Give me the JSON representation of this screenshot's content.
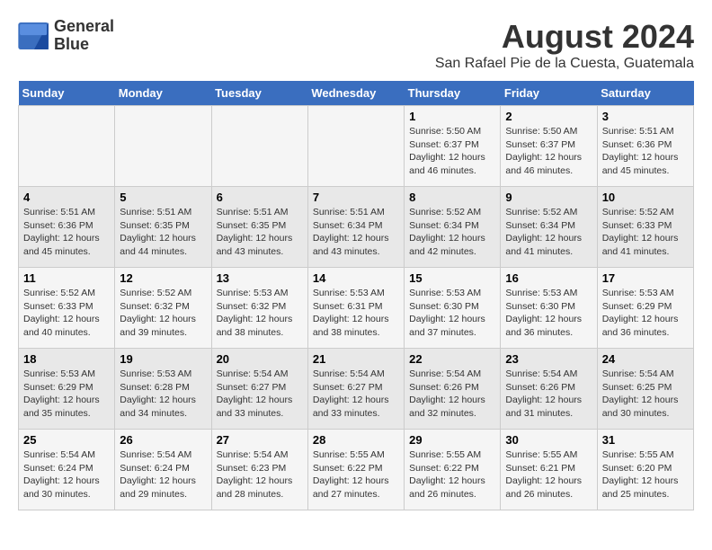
{
  "logo": {
    "line1": "General",
    "line2": "Blue"
  },
  "title": "August 2024",
  "subtitle": "San Rafael Pie de la Cuesta, Guatemala",
  "days_of_week": [
    "Sunday",
    "Monday",
    "Tuesday",
    "Wednesday",
    "Thursday",
    "Friday",
    "Saturday"
  ],
  "weeks": [
    [
      {
        "day": "",
        "info": ""
      },
      {
        "day": "",
        "info": ""
      },
      {
        "day": "",
        "info": ""
      },
      {
        "day": "",
        "info": ""
      },
      {
        "day": "1",
        "info": "Sunrise: 5:50 AM\nSunset: 6:37 PM\nDaylight: 12 hours\nand 46 minutes."
      },
      {
        "day": "2",
        "info": "Sunrise: 5:50 AM\nSunset: 6:37 PM\nDaylight: 12 hours\nand 46 minutes."
      },
      {
        "day": "3",
        "info": "Sunrise: 5:51 AM\nSunset: 6:36 PM\nDaylight: 12 hours\nand 45 minutes."
      }
    ],
    [
      {
        "day": "4",
        "info": "Sunrise: 5:51 AM\nSunset: 6:36 PM\nDaylight: 12 hours\nand 45 minutes."
      },
      {
        "day": "5",
        "info": "Sunrise: 5:51 AM\nSunset: 6:35 PM\nDaylight: 12 hours\nand 44 minutes."
      },
      {
        "day": "6",
        "info": "Sunrise: 5:51 AM\nSunset: 6:35 PM\nDaylight: 12 hours\nand 43 minutes."
      },
      {
        "day": "7",
        "info": "Sunrise: 5:51 AM\nSunset: 6:34 PM\nDaylight: 12 hours\nand 43 minutes."
      },
      {
        "day": "8",
        "info": "Sunrise: 5:52 AM\nSunset: 6:34 PM\nDaylight: 12 hours\nand 42 minutes."
      },
      {
        "day": "9",
        "info": "Sunrise: 5:52 AM\nSunset: 6:34 PM\nDaylight: 12 hours\nand 41 minutes."
      },
      {
        "day": "10",
        "info": "Sunrise: 5:52 AM\nSunset: 6:33 PM\nDaylight: 12 hours\nand 41 minutes."
      }
    ],
    [
      {
        "day": "11",
        "info": "Sunrise: 5:52 AM\nSunset: 6:33 PM\nDaylight: 12 hours\nand 40 minutes."
      },
      {
        "day": "12",
        "info": "Sunrise: 5:52 AM\nSunset: 6:32 PM\nDaylight: 12 hours\nand 39 minutes."
      },
      {
        "day": "13",
        "info": "Sunrise: 5:53 AM\nSunset: 6:32 PM\nDaylight: 12 hours\nand 38 minutes."
      },
      {
        "day": "14",
        "info": "Sunrise: 5:53 AM\nSunset: 6:31 PM\nDaylight: 12 hours\nand 38 minutes."
      },
      {
        "day": "15",
        "info": "Sunrise: 5:53 AM\nSunset: 6:30 PM\nDaylight: 12 hours\nand 37 minutes."
      },
      {
        "day": "16",
        "info": "Sunrise: 5:53 AM\nSunset: 6:30 PM\nDaylight: 12 hours\nand 36 minutes."
      },
      {
        "day": "17",
        "info": "Sunrise: 5:53 AM\nSunset: 6:29 PM\nDaylight: 12 hours\nand 36 minutes."
      }
    ],
    [
      {
        "day": "18",
        "info": "Sunrise: 5:53 AM\nSunset: 6:29 PM\nDaylight: 12 hours\nand 35 minutes."
      },
      {
        "day": "19",
        "info": "Sunrise: 5:53 AM\nSunset: 6:28 PM\nDaylight: 12 hours\nand 34 minutes."
      },
      {
        "day": "20",
        "info": "Sunrise: 5:54 AM\nSunset: 6:27 PM\nDaylight: 12 hours\nand 33 minutes."
      },
      {
        "day": "21",
        "info": "Sunrise: 5:54 AM\nSunset: 6:27 PM\nDaylight: 12 hours\nand 33 minutes."
      },
      {
        "day": "22",
        "info": "Sunrise: 5:54 AM\nSunset: 6:26 PM\nDaylight: 12 hours\nand 32 minutes."
      },
      {
        "day": "23",
        "info": "Sunrise: 5:54 AM\nSunset: 6:26 PM\nDaylight: 12 hours\nand 31 minutes."
      },
      {
        "day": "24",
        "info": "Sunrise: 5:54 AM\nSunset: 6:25 PM\nDaylight: 12 hours\nand 30 minutes."
      }
    ],
    [
      {
        "day": "25",
        "info": "Sunrise: 5:54 AM\nSunset: 6:24 PM\nDaylight: 12 hours\nand 30 minutes."
      },
      {
        "day": "26",
        "info": "Sunrise: 5:54 AM\nSunset: 6:24 PM\nDaylight: 12 hours\nand 29 minutes."
      },
      {
        "day": "27",
        "info": "Sunrise: 5:54 AM\nSunset: 6:23 PM\nDaylight: 12 hours\nand 28 minutes."
      },
      {
        "day": "28",
        "info": "Sunrise: 5:55 AM\nSunset: 6:22 PM\nDaylight: 12 hours\nand 27 minutes."
      },
      {
        "day": "29",
        "info": "Sunrise: 5:55 AM\nSunset: 6:22 PM\nDaylight: 12 hours\nand 26 minutes."
      },
      {
        "day": "30",
        "info": "Sunrise: 5:55 AM\nSunset: 6:21 PM\nDaylight: 12 hours\nand 26 minutes."
      },
      {
        "day": "31",
        "info": "Sunrise: 5:55 AM\nSunset: 6:20 PM\nDaylight: 12 hours\nand 25 minutes."
      }
    ]
  ]
}
